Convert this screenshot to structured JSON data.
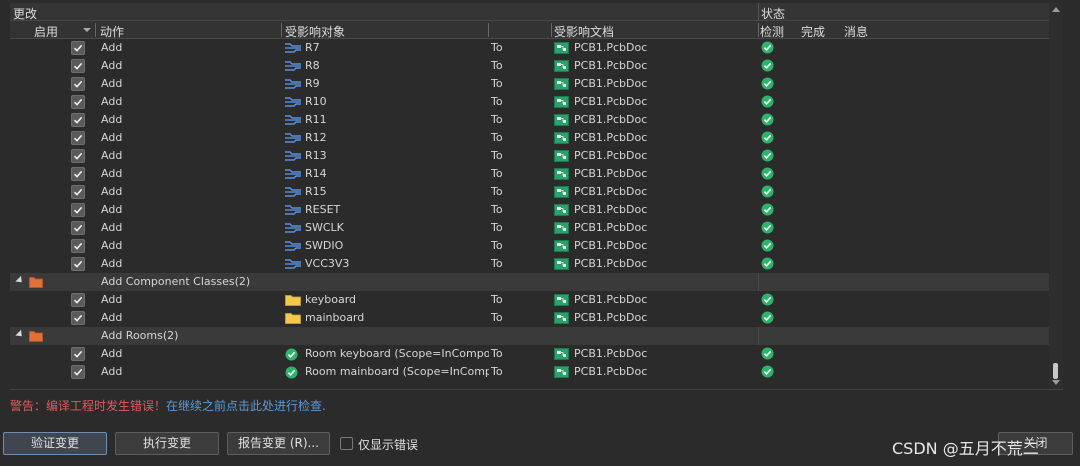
{
  "header": {
    "changes": "更改",
    "status": "状态"
  },
  "columns": {
    "enabled": "启用",
    "action": "动作",
    "affected_object": "受影响对象",
    "affected_document": "受影响文档",
    "check": "检测",
    "done": "完成",
    "message": "消息"
  },
  "rows": [
    {
      "type": "item",
      "action": "Add",
      "object_icon": "net-icon",
      "object": "R7",
      "to": "To",
      "document": "PCB1.PcbDoc",
      "checked": true
    },
    {
      "type": "item",
      "action": "Add",
      "object_icon": "net-icon",
      "object": "R8",
      "to": "To",
      "document": "PCB1.PcbDoc",
      "checked": true
    },
    {
      "type": "item",
      "action": "Add",
      "object_icon": "net-icon",
      "object": "R9",
      "to": "To",
      "document": "PCB1.PcbDoc",
      "checked": true
    },
    {
      "type": "item",
      "action": "Add",
      "object_icon": "net-icon",
      "object": "R10",
      "to": "To",
      "document": "PCB1.PcbDoc",
      "checked": true
    },
    {
      "type": "item",
      "action": "Add",
      "object_icon": "net-icon",
      "object": "R11",
      "to": "To",
      "document": "PCB1.PcbDoc",
      "checked": true
    },
    {
      "type": "item",
      "action": "Add",
      "object_icon": "net-icon",
      "object": "R12",
      "to": "To",
      "document": "PCB1.PcbDoc",
      "checked": true
    },
    {
      "type": "item",
      "action": "Add",
      "object_icon": "net-icon",
      "object": "R13",
      "to": "To",
      "document": "PCB1.PcbDoc",
      "checked": true
    },
    {
      "type": "item",
      "action": "Add",
      "object_icon": "net-icon",
      "object": "R14",
      "to": "To",
      "document": "PCB1.PcbDoc",
      "checked": true
    },
    {
      "type": "item",
      "action": "Add",
      "object_icon": "net-icon",
      "object": "R15",
      "to": "To",
      "document": "PCB1.PcbDoc",
      "checked": true
    },
    {
      "type": "item",
      "action": "Add",
      "object_icon": "net-icon",
      "object": "RESET",
      "to": "To",
      "document": "PCB1.PcbDoc",
      "checked": true
    },
    {
      "type": "item",
      "action": "Add",
      "object_icon": "net-icon",
      "object": "SWCLK",
      "to": "To",
      "document": "PCB1.PcbDoc",
      "checked": true
    },
    {
      "type": "item",
      "action": "Add",
      "object_icon": "net-icon",
      "object": "SWDIO",
      "to": "To",
      "document": "PCB1.PcbDoc",
      "checked": true
    },
    {
      "type": "item",
      "action": "Add",
      "object_icon": "net-icon",
      "object": "VCC3V3",
      "to": "To",
      "document": "PCB1.PcbDoc",
      "checked": true
    },
    {
      "type": "group",
      "label": "Add Component Classes(2)"
    },
    {
      "type": "item",
      "action": "Add",
      "object_icon": "folder-icon",
      "object": "keyboard",
      "to": "To",
      "document": "PCB1.PcbDoc",
      "checked": true
    },
    {
      "type": "item",
      "action": "Add",
      "object_icon": "folder-icon",
      "object": "mainboard",
      "to": "To",
      "document": "PCB1.PcbDoc",
      "checked": true
    },
    {
      "type": "group",
      "label": "Add Rooms(2)"
    },
    {
      "type": "item",
      "action": "Add",
      "object_icon": "room-check-icon",
      "object": "Room keyboard (Scope=InComponentClass('keyboard'))",
      "to": "To",
      "document": "PCB1.PcbDoc",
      "checked": true
    },
    {
      "type": "item",
      "action": "Add",
      "object_icon": "room-check-icon",
      "object": "Room mainboard (Scope=InComponentClass('mainboard'))",
      "to": "To",
      "document": "PCB1.PcbDoc",
      "checked": true
    }
  ],
  "warning": {
    "prefix": "警告：编译工程时发生错误！",
    "link": "在继续之前点击此处进行检查."
  },
  "buttons": {
    "validate": "验证变更",
    "execute": "执行变更",
    "report": "报告变更 (R)...",
    "only_errors": "仅显示错误",
    "close": "关闭"
  },
  "watermark": "CSDN @五月不荒二",
  "colors": {
    "ok_green": "#2db36b",
    "warning_red": "#e05a5a",
    "link_blue": "#5a9bd8",
    "net_blue": "#5b8fe0",
    "folder_yellow": "#f2c94c",
    "group_folder_orange": "#e0703a",
    "pcb_green": "#2aa06a"
  }
}
